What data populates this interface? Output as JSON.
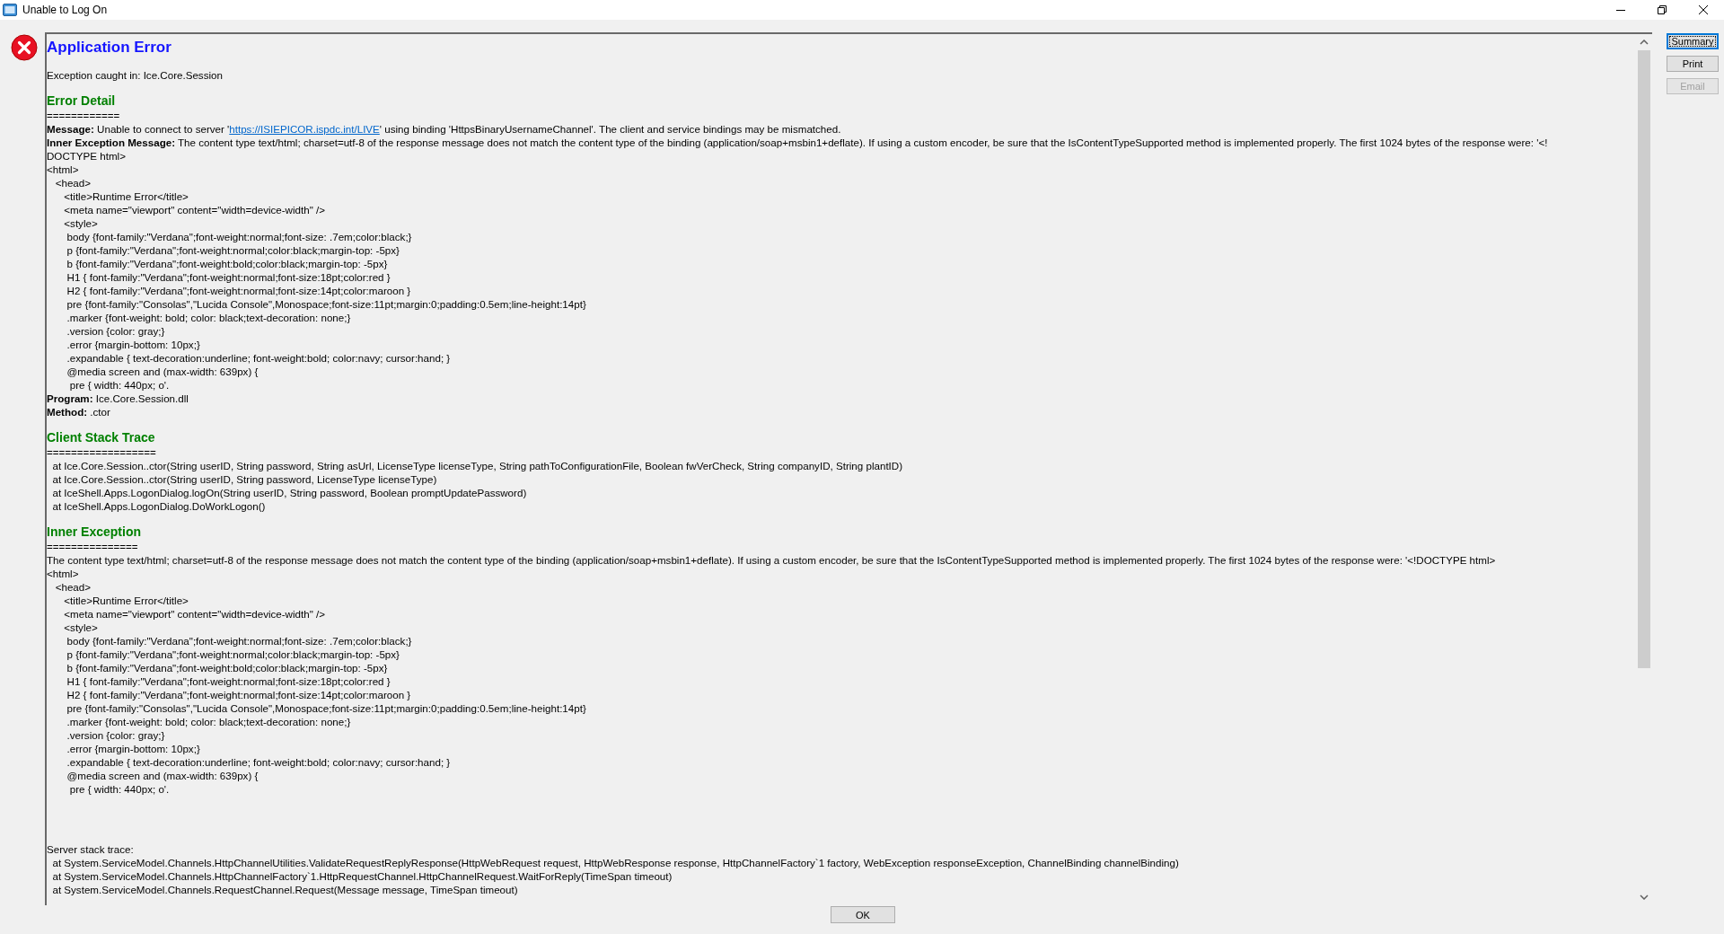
{
  "window": {
    "title": "Unable to Log On"
  },
  "details": {
    "lines": [
      {
        "kind": "title",
        "text": "Application Error"
      },
      {
        "kind": "plain",
        "text": "Exception caught in: Ice.Core.Session"
      },
      {
        "kind": "section",
        "text": "Error Detail"
      },
      {
        "kind": "plain",
        "text": "============"
      },
      {
        "kind": "field",
        "label": "Message:",
        "text": " Unable to connect to server '",
        "link": "https://ISIEPICOR.ispdc.int/LIVE",
        "after": "' using binding 'HttpsBinaryUsernameChannel'. The client and service bindings may be mismatched."
      },
      {
        "kind": "field",
        "label": "Inner Exception Message:",
        "text": " The content type text/html; charset=utf-8 of the response message does not match the content type of the binding (application/soap+msbin1+deflate). If using a custom encoder, be sure that the IsContentTypeSupported method is implemented properly. The first 1024 bytes of the response were: '<!"
      },
      {
        "kind": "plain",
        "text": "DOCTYPE html>"
      },
      {
        "kind": "plain",
        "text": "<html>"
      },
      {
        "kind": "plain",
        "text": "   <head>"
      },
      {
        "kind": "plain",
        "text": "      <title>Runtime Error</title>"
      },
      {
        "kind": "plain",
        "text": "      <meta name=\"viewport\" content=\"width=device-width\" />"
      },
      {
        "kind": "plain",
        "text": "      <style>"
      },
      {
        "kind": "plain",
        "text": "       body {font-family:\"Verdana\";font-weight:normal;font-size: .7em;color:black;}"
      },
      {
        "kind": "plain",
        "text": "       p {font-family:\"Verdana\";font-weight:normal;color:black;margin-top: -5px}"
      },
      {
        "kind": "plain",
        "text": "       b {font-family:\"Verdana\";font-weight:bold;color:black;margin-top: -5px}"
      },
      {
        "kind": "plain",
        "text": "       H1 { font-family:\"Verdana\";font-weight:normal;font-size:18pt;color:red }"
      },
      {
        "kind": "plain",
        "text": "       H2 { font-family:\"Verdana\";font-weight:normal;font-size:14pt;color:maroon }"
      },
      {
        "kind": "plain",
        "text": "       pre {font-family:\"Consolas\",\"Lucida Console\",Monospace;font-size:11pt;margin:0;padding:0.5em;line-height:14pt}"
      },
      {
        "kind": "plain",
        "text": "       .marker {font-weight: bold; color: black;text-decoration: none;}"
      },
      {
        "kind": "plain",
        "text": "       .version {color: gray;}"
      },
      {
        "kind": "plain",
        "text": "       .error {margin-bottom: 10px;}"
      },
      {
        "kind": "plain",
        "text": "       .expandable { text-decoration:underline; font-weight:bold; color:navy; cursor:hand; }"
      },
      {
        "kind": "plain",
        "text": "       @media screen and (max-width: 639px) {"
      },
      {
        "kind": "plain",
        "text": "        pre { width: 440px; o'."
      },
      {
        "kind": "field",
        "label": "Program:",
        "text": " Ice.Core.Session.dll"
      },
      {
        "kind": "field",
        "label": "Method:",
        "text": " .ctor"
      },
      {
        "kind": "section",
        "text": "Client Stack Trace"
      },
      {
        "kind": "plain",
        "text": "=================="
      },
      {
        "kind": "plain",
        "text": "  at Ice.Core.Session..ctor(String userID, String password, String asUrl, LicenseType licenseType, String pathToConfigurationFile, Boolean fwVerCheck, String companyID, String plantID)"
      },
      {
        "kind": "plain",
        "text": "  at Ice.Core.Session..ctor(String userID, String password, LicenseType licenseType)"
      },
      {
        "kind": "plain",
        "text": "  at IceShell.Apps.LogonDialog.logOn(String userID, String password, Boolean promptUpdatePassword)"
      },
      {
        "kind": "plain",
        "text": "  at IceShell.Apps.LogonDialog.DoWorkLogon()"
      },
      {
        "kind": "section",
        "text": "Inner Exception"
      },
      {
        "kind": "plain",
        "text": "==============="
      },
      {
        "kind": "plain",
        "text": "The content type text/html; charset=utf-8 of the response message does not match the content type of the binding (application/soap+msbin1+deflate). If using a custom encoder, be sure that the IsContentTypeSupported method is implemented properly. The first 1024 bytes of the response were: '<!DOCTYPE html>"
      },
      {
        "kind": "plain",
        "text": "<html>"
      },
      {
        "kind": "plain",
        "text": "   <head>"
      },
      {
        "kind": "plain",
        "text": "      <title>Runtime Error</title>"
      },
      {
        "kind": "plain",
        "text": "      <meta name=\"viewport\" content=\"width=device-width\" />"
      },
      {
        "kind": "plain",
        "text": "      <style>"
      },
      {
        "kind": "plain",
        "text": "       body {font-family:\"Verdana\";font-weight:normal;font-size: .7em;color:black;}"
      },
      {
        "kind": "plain",
        "text": "       p {font-family:\"Verdana\";font-weight:normal;color:black;margin-top: -5px}"
      },
      {
        "kind": "plain",
        "text": "       b {font-family:\"Verdana\";font-weight:bold;color:black;margin-top: -5px}"
      },
      {
        "kind": "plain",
        "text": "       H1 { font-family:\"Verdana\";font-weight:normal;font-size:18pt;color:red }"
      },
      {
        "kind": "plain",
        "text": "       H2 { font-family:\"Verdana\";font-weight:normal;font-size:14pt;color:maroon }"
      },
      {
        "kind": "plain",
        "text": "       pre {font-family:\"Consolas\",\"Lucida Console\",Monospace;font-size:11pt;margin:0;padding:0.5em;line-height:14pt}"
      },
      {
        "kind": "plain",
        "text": "       .marker {font-weight: bold; color: black;text-decoration: none;}"
      },
      {
        "kind": "plain",
        "text": "       .version {color: gray;}"
      },
      {
        "kind": "plain",
        "text": "       .error {margin-bottom: 10px;}"
      },
      {
        "kind": "plain",
        "text": "       .expandable { text-decoration:underline; font-weight:bold; color:navy; cursor:hand; }"
      },
      {
        "kind": "plain",
        "text": "       @media screen and (max-width: 639px) {"
      },
      {
        "kind": "plain",
        "text": "        pre { width: 440px; o'."
      },
      {
        "kind": "note",
        "text": "Server stack trace: "
      },
      {
        "kind": "plain",
        "text": "  at System.ServiceModel.Channels.HttpChannelUtilities.ValidateRequestReplyResponse(HttpWebRequest request, HttpWebResponse response, HttpChannelFactory`1 factory, WebException responseException, ChannelBinding channelBinding)"
      },
      {
        "kind": "plain",
        "text": "  at System.ServiceModel.Channels.HttpChannelFactory`1.HttpRequestChannel.HttpChannelRequest.WaitForReply(TimeSpan timeout)"
      },
      {
        "kind": "plain",
        "text": "  at System.ServiceModel.Channels.RequestChannel.Request(Message message, TimeSpan timeout)"
      }
    ]
  },
  "side_buttons": [
    {
      "label": "Summary",
      "selected": true,
      "disabled": false
    },
    {
      "label": "Print",
      "selected": false,
      "disabled": false
    },
    {
      "label": "Email",
      "selected": false,
      "disabled": true
    }
  ],
  "buttons": [
    "OK"
  ]
}
